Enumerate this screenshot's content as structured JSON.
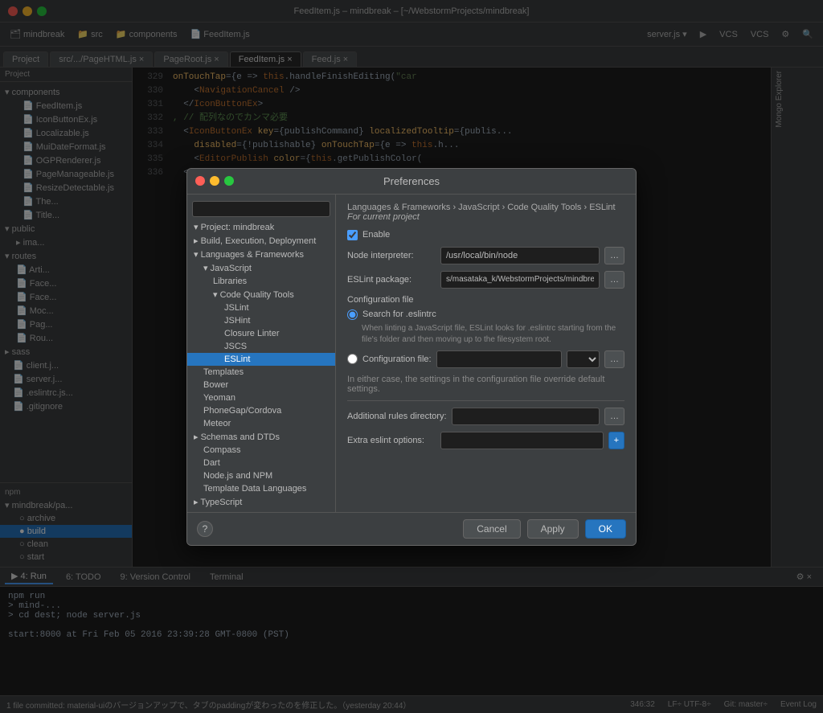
{
  "titlebar": {
    "title": "FeedItem.js – mindbreak – [~/WebstormProjects/mindbreak]"
  },
  "toolbar": {
    "items": [
      "mindbreak",
      "src",
      "components",
      "FeedItem.js"
    ]
  },
  "tabs": {
    "items": [
      {
        "label": "Project",
        "active": false
      },
      {
        "label": "src/.../PageHTML.js",
        "active": false
      },
      {
        "label": "PageRoot.js",
        "active": false
      },
      {
        "label": "FeedItem.js",
        "active": true
      },
      {
        "label": "Feed.js",
        "active": false
      }
    ]
  },
  "sidebar": {
    "project_label": "Project",
    "files": [
      {
        "name": "FeedItem.js",
        "indent": 2
      },
      {
        "name": "IconButtonEx.js",
        "indent": 2
      },
      {
        "name": "Localizable.js",
        "indent": 2
      },
      {
        "name": "MuiDateFormat.js",
        "indent": 2
      },
      {
        "name": "OGPRenderer.js",
        "indent": 2
      },
      {
        "name": "PageManageable.js",
        "indent": 2
      },
      {
        "name": "ResizeDetectable.js",
        "indent": 2
      },
      {
        "name": "Th...",
        "indent": 2
      },
      {
        "name": "Title...",
        "indent": 2
      }
    ],
    "folders": [
      "public",
      "ima...",
      "routes",
      "Arti...",
      "Face...",
      "Face...",
      "Moc...",
      "Pag...",
      "Rou...",
      "sass",
      "client.j...",
      "server.j...",
      ".eslintrc.js...",
      ".gitignore"
    ],
    "npm": {
      "label": "npm",
      "items": [
        {
          "name": "mindbreak/pa...",
          "expand": true
        },
        {
          "name": "archive",
          "dot": "circle"
        },
        {
          "name": "build",
          "dot": "filled",
          "selected": true
        },
        {
          "name": "clean",
          "dot": "circle"
        },
        {
          "name": "start",
          "dot": "circle"
        }
      ]
    }
  },
  "code": {
    "lines": [
      {
        "num": "329",
        "content": "onTouchTap={e => this.handleFinishEditing(\"car"
      },
      {
        "num": "330",
        "content": "    <NavigationCancel />"
      },
      {
        "num": "331",
        "content": "  </IconButtonEx>"
      },
      {
        "num": "332",
        "content": ", // 配列なのでカンマ必要"
      },
      {
        "num": "333",
        "content": "  <IconButtonEx key={publishCommand} localizedTooltip={publis..."
      },
      {
        "num": "334",
        "content": "    disabled={!publishable} onTouchTap={e => this.h..."
      },
      {
        "num": "335",
        "content": "    <EditorPublish color={this.getPublishColor("
      }
    ]
  },
  "dialog": {
    "title": "Preferences",
    "traffic_lights": [
      "red",
      "yellow",
      "green"
    ],
    "breadcrumb": "Languages & Frameworks › JavaScript › Code Quality Tools › ESLint",
    "breadcrumb_suffix": "For current project",
    "search_placeholder": "",
    "tree": {
      "items": [
        {
          "label": "Project: mindbreak",
          "level": 0,
          "expanded": true
        },
        {
          "label": "Build, Execution, Deployment",
          "level": 0,
          "expanded": false
        },
        {
          "label": "Languages & Frameworks",
          "level": 0,
          "expanded": true
        },
        {
          "label": "JavaScript",
          "level": 1,
          "expanded": true
        },
        {
          "label": "Libraries",
          "level": 2
        },
        {
          "label": "Code Quality Tools",
          "level": 2,
          "expanded": true
        },
        {
          "label": "JSLint",
          "level": 3
        },
        {
          "label": "JSHint",
          "level": 3
        },
        {
          "label": "Closure Linter",
          "level": 3
        },
        {
          "label": "JSCS",
          "level": 3
        },
        {
          "label": "ESLint",
          "level": 3,
          "selected": true
        },
        {
          "label": "Templates",
          "level": 1
        },
        {
          "label": "Bower",
          "level": 1
        },
        {
          "label": "Yeoman",
          "level": 1
        },
        {
          "label": "PhoneGap/Cordova",
          "level": 1
        },
        {
          "label": "Meteor",
          "level": 1
        },
        {
          "label": "Schemas and DTDs",
          "level": 0,
          "expanded": false
        },
        {
          "label": "Compass",
          "level": 1
        },
        {
          "label": "Dart",
          "level": 1
        },
        {
          "label": "Node.js and NPM",
          "level": 1
        },
        {
          "label": "Template Data Languages",
          "level": 1
        },
        {
          "label": "TypeScript",
          "level": 0
        }
      ]
    },
    "form": {
      "enable_label": "Enable",
      "enable_checked": true,
      "node_interpreter_label": "Node interpreter:",
      "node_interpreter_value": "/usr/local/bin/node",
      "eslint_package_label": "ESLint package:",
      "eslint_package_value": "s/masataka_k/WebstormProjects/mindbreak/node_modules/eslir",
      "config_file_header": "Configuration file",
      "radio_search_label": "Search for .eslintrc",
      "radio_search_desc": "When linting a JavaScript file, ESLint looks for .eslintrc starting from the file's folder and then moving up to the filesystem root.",
      "radio_config_label": "Configuration file:",
      "info_text": "In either case, the settings in the configuration file override default settings.",
      "additional_rules_label": "Additional rules directory:",
      "extra_eslint_label": "Extra eslint options:"
    },
    "footer": {
      "cancel_label": "Cancel",
      "apply_label": "Apply",
      "ok_label": "OK"
    }
  },
  "bottom": {
    "tabs": [
      {
        "label": "4: Run",
        "active": true
      },
      {
        "label": "6: TODO",
        "active": false
      },
      {
        "label": "9: Version Control",
        "active": false
      },
      {
        "label": "Terminal",
        "active": false
      }
    ],
    "run_label": "npm run",
    "terminal_lines": [
      "> mind-...",
      "> cd dest; node server.js",
      "",
      "start:8000 at Fri Feb 05 2016 23:39:28 GMT-0800 (PST)"
    ]
  },
  "statusbar": {
    "git_status": "1 file committed: material-uiのバージョンアップで、タブのpaddingが変わったのを修正した。（yesterday 20:44）",
    "position": "346:32",
    "encoding": "LF÷ UTF-8÷",
    "branch": "Git: master÷",
    "event_log": "Event Log"
  }
}
